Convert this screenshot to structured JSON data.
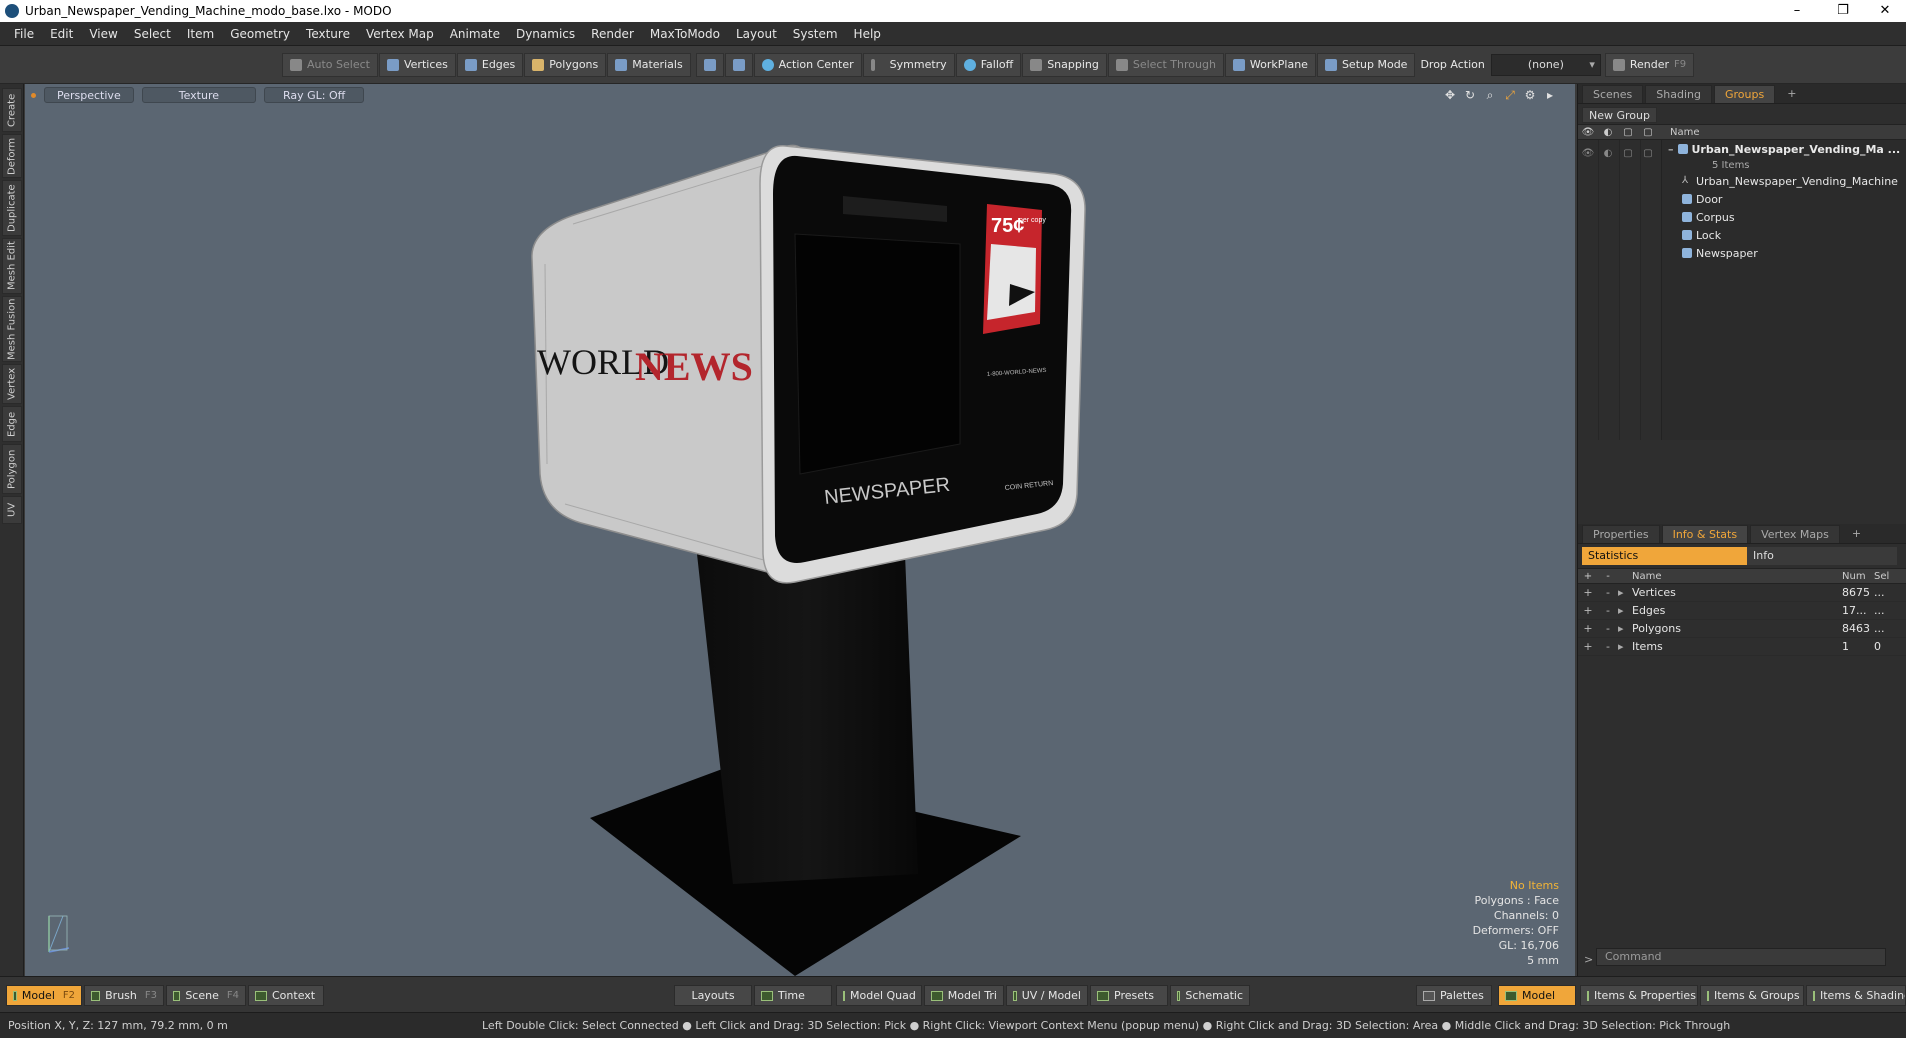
{
  "window": {
    "title": "Urban_Newspaper_Vending_Machine_modo_base.lxo - MODO",
    "minimize": "–",
    "restore": "❐",
    "close": "✕"
  },
  "menu": [
    "File",
    "Edit",
    "View",
    "Select",
    "Item",
    "Geometry",
    "Texture",
    "Vertex Map",
    "Animate",
    "Dynamics",
    "Render",
    "MaxToModo",
    "Layout",
    "System",
    "Help"
  ],
  "toolbar": {
    "auto_select": "Auto Select",
    "vertices": "Vertices",
    "edges": "Edges",
    "polygons": "Polygons",
    "materials": "Materials",
    "action_center": "Action Center",
    "symmetry": "Symmetry",
    "falloff": "Falloff",
    "snapping": "Snapping",
    "select_through": "Select Through",
    "workplane": "WorkPlane",
    "setup_mode": "Setup Mode",
    "drop_action": "Drop Action",
    "drop_value": "(none)",
    "render": "Render",
    "render_key": "F9"
  },
  "left_tabs": [
    "Create",
    "Deform",
    "Duplicate",
    "Mesh Edit",
    "Mesh Fusion",
    "Vertex",
    "Edge",
    "Polygon",
    "UV"
  ],
  "viewport": {
    "view_mode": "Perspective",
    "shading": "Texture",
    "raygl": "Ray GL: Off",
    "info": {
      "items": "No Items",
      "polygons": "Polygons : Face",
      "channels": "Channels: 0",
      "deformers": "Deformers: OFF",
      "gl": "GL: 16,706",
      "unit": "5 mm"
    },
    "model": {
      "brand_world": "WORLD",
      "brand_news": "NEWS",
      "front_label": "NEWSPAPER",
      "price": "75¢",
      "price_sub": "per copy",
      "phone": "1-800-WORLD-NEWS",
      "coin_return": "COIN RETURN"
    }
  },
  "groups_panel": {
    "tabs": [
      "Scenes",
      "Shading",
      "Groups"
    ],
    "active_tab": "Groups",
    "new_group": "New Group",
    "col_name": "Name",
    "root": "Urban_Newspaper_Vending_Ma ...",
    "root_count": "5 Items",
    "children": [
      "Urban_Newspaper_Vending_Machine",
      "Door",
      "Corpus",
      "Lock",
      "Newspaper"
    ]
  },
  "stats_panel": {
    "tabs": [
      "Properties",
      "Info & Stats",
      "Vertex Maps"
    ],
    "active_tab": "Info & Stats",
    "statistics": "Statistics",
    "info": "Info",
    "col_name": "Name",
    "col_num": "Num",
    "col_sel": "Sel",
    "rows": [
      {
        "name": "Vertices",
        "num": "8675",
        "sel": "..."
      },
      {
        "name": "Edges",
        "num": "17...",
        "sel": "..."
      },
      {
        "name": "Polygons",
        "num": "8463",
        "sel": "..."
      },
      {
        "name": "Items",
        "num": "1",
        "sel": "0"
      }
    ],
    "command_placeholder": "Command"
  },
  "bottom": {
    "model": "Model",
    "model_key": "F2",
    "brush": "Brush",
    "brush_key": "F3",
    "scene": "Scene",
    "scene_key": "F4",
    "context": "Context",
    "layouts": "Layouts",
    "time": "Time",
    "model_quad": "Model Quad",
    "model_tri": "Model Tri",
    "uv_model": "UV / Model",
    "presets": "Presets",
    "schematic": "Schematic",
    "palettes": "Palettes",
    "model2": "Model",
    "items_properties": "Items & Properties",
    "items_groups": "Items & Groups",
    "items_shading": "Items & Shading"
  },
  "status": {
    "position": "Position X, Y, Z:   127 mm, 79.2 mm, 0 m",
    "hints": "Left Double Click: Select Connected ● Left Click and Drag: 3D Selection: Pick ● Right Click: Viewport Context Menu (popup menu) ● Right Click and Drag: 3D Selection: Area ● Middle Click and Drag: 3D Selection: Pick Through"
  },
  "colors": {
    "accent": "#f0a63a",
    "viewport_bg": "#5b6672",
    "news_red": "#b3262d"
  }
}
